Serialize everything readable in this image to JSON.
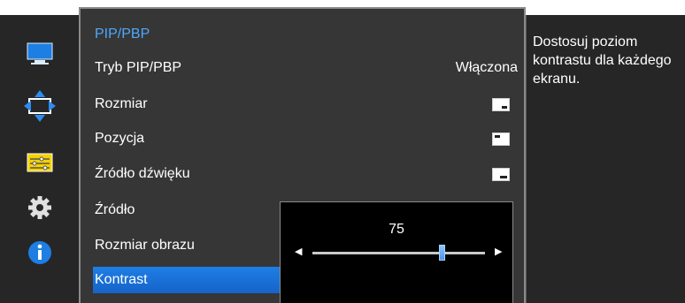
{
  "menu": {
    "title": "PIP/PBP",
    "items": [
      {
        "label": "Tryb PIP/PBP",
        "value": "Włączona"
      },
      {
        "label": "Rozmiar",
        "value": ""
      },
      {
        "label": "Pozycja",
        "value": ""
      },
      {
        "label": "Źródło dźwięku",
        "value": ""
      },
      {
        "label": "Źródło",
        "value": ""
      },
      {
        "label": "Rozmiar obrazu",
        "value": ""
      },
      {
        "label": "Kontrast",
        "value": ""
      }
    ],
    "selected_index": 6
  },
  "slider": {
    "value": "75",
    "level": 0.75
  },
  "help": {
    "text": "Dostosuj poziom kontrastu dla każdego ekranu."
  },
  "icons": {
    "rail": [
      "monitor-icon",
      "move-arrows-icon",
      "sliders-icon",
      "gear-icon",
      "info-icon"
    ],
    "accent": "#1f7ee6"
  }
}
